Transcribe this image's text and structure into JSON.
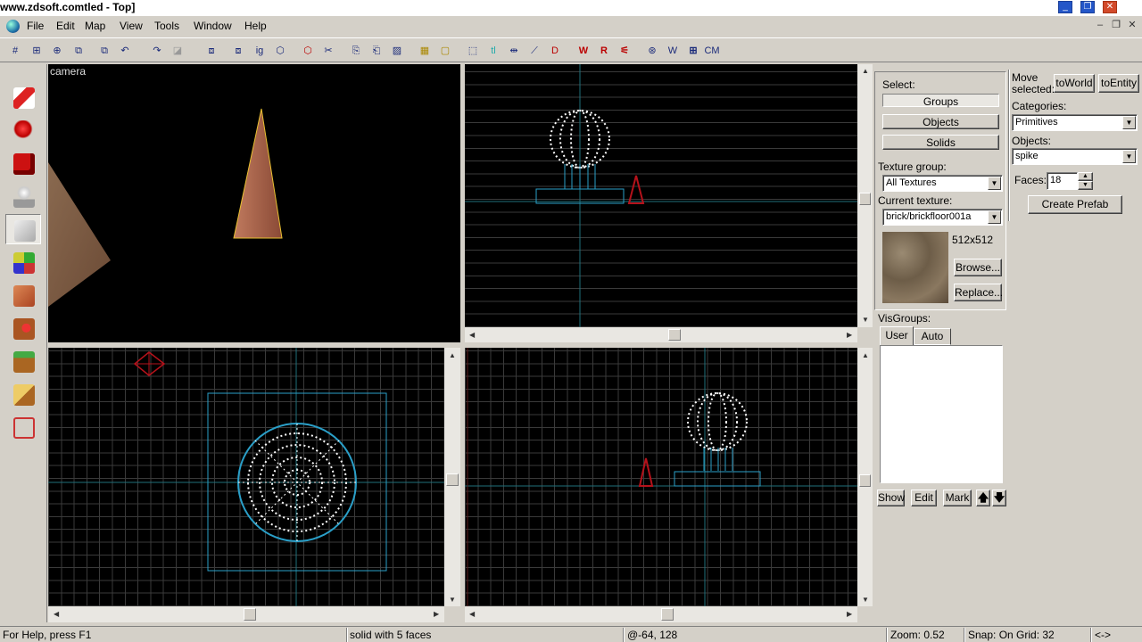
{
  "window": {
    "title_prefix": "www.zdsoft.com",
    "title_suffix": "tled - Top]",
    "controls": [
      "_",
      "❐",
      "✕"
    ]
  },
  "menu": [
    "File",
    "Edit",
    "Map",
    "View",
    "Tools",
    "Window",
    "Help"
  ],
  "mdi_controls": [
    "–",
    "❐",
    "✕"
  ],
  "toolbar": {
    "buttons": [
      "#",
      "⊞",
      "⊕",
      "⧉",
      "⧉",
      "↶",
      "↷",
      "◪",
      "⧈",
      "⧈",
      "ig",
      "⬡",
      "⬡",
      "✂",
      "⎘",
      "⎗",
      "▨",
      "▦",
      "▢",
      "⬚",
      "tl",
      "⇹",
      "⟋",
      "D",
      "W",
      "R",
      "⚟",
      "⊛",
      "W",
      "⊞",
      "CM"
    ]
  },
  "tools": [
    "selection-tool",
    "magnify-tool",
    "camera-tool",
    "entity-tool",
    "block-tool",
    "texture-tool",
    "apply-texture-tool",
    "decal-tool",
    "overlay-tool",
    "clipping-tool",
    "vertex-tool"
  ],
  "viewports": {
    "camera_label": "camera"
  },
  "right_panel": {
    "select_label": "Select:",
    "select_buttons": [
      "Groups",
      "Objects",
      "Solids"
    ],
    "texture_group_label": "Texture group:",
    "texture_group_value": "All Textures",
    "current_texture_label": "Current texture:",
    "current_texture_value": "brick/brickfloor001a",
    "texture_size": "512x512",
    "browse_button": "Browse...",
    "replace_button": "Replace...",
    "visgroups_label": "VisGroups:",
    "visgroup_tabs": [
      "User",
      "Auto"
    ],
    "visgroup_buttons": [
      "Show",
      "Edit",
      "Mark"
    ],
    "move_selected_label_1": "Move",
    "move_selected_label_2": "selected:",
    "to_world_button": "toWorld",
    "to_entity_button": "toEntity",
    "categories_label": "Categories:",
    "categories_value": "Primitives",
    "objects_label": "Objects:",
    "objects_value": "spike",
    "faces_label": "Faces:",
    "faces_value": "18",
    "create_prefab_button": "Create Prefab"
  },
  "status": {
    "help": "For Help, press F1",
    "selection": "solid with 5 faces",
    "coords": "@-64, 128",
    "zoom": "Zoom: 0.52",
    "snap": "Snap: On Grid: 32",
    "nav": "<->"
  },
  "colors": {
    "grid": "#3a3a3a",
    "axis": "#1f6f7a",
    "selection": "#2a9fc8",
    "vertex": "#ffffff",
    "spike": "#b5121b"
  }
}
